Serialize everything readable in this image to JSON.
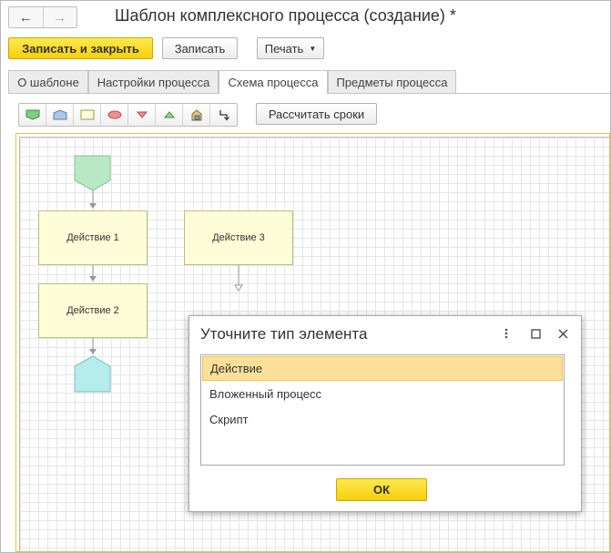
{
  "window": {
    "title": "Шаблон комплексного процесса (создание) *",
    "nav_back": "←",
    "nav_forward": "→"
  },
  "commands": {
    "save_close": "Записать и закрыть",
    "save": "Записать",
    "print": "Печать"
  },
  "tabs": [
    {
      "label": "О шаблоне"
    },
    {
      "label": "Настройки процесса"
    },
    {
      "label": "Схема процесса"
    },
    {
      "label": "Предметы процесса"
    }
  ],
  "toolbar": {
    "tools": [
      {
        "icon": "start-shape-icon",
        "color": "#7ed081"
      },
      {
        "icon": "end-shape-icon",
        "color": "#a9c8e8"
      },
      {
        "icon": "action-shape-icon",
        "color": "#fdfdd7"
      },
      {
        "icon": "condition-shape-icon",
        "color": "#f08e8e"
      },
      {
        "icon": "split-shape-icon",
        "color": "#f08e8e"
      },
      {
        "icon": "join-shape-icon",
        "color": "#8fd88f"
      },
      {
        "icon": "nested-process-icon",
        "color": "#e0c070"
      },
      {
        "icon": "connector-icon",
        "color": "#333333"
      }
    ],
    "calc_deadlines": "Рассчитать сроки"
  },
  "diagram": {
    "nodes": [
      {
        "label": "Действие 1"
      },
      {
        "label": "Действие 2"
      },
      {
        "label": "Действие 3"
      }
    ],
    "start_color": "#b8e8c4",
    "end_color": "#b5ecec"
  },
  "dialog": {
    "title": "Уточните тип элемента",
    "items": [
      {
        "label": "Действие",
        "selected": true
      },
      {
        "label": "Вложенный процесс",
        "selected": false
      },
      {
        "label": "Скрипт",
        "selected": false
      }
    ],
    "ok": "ОК"
  }
}
